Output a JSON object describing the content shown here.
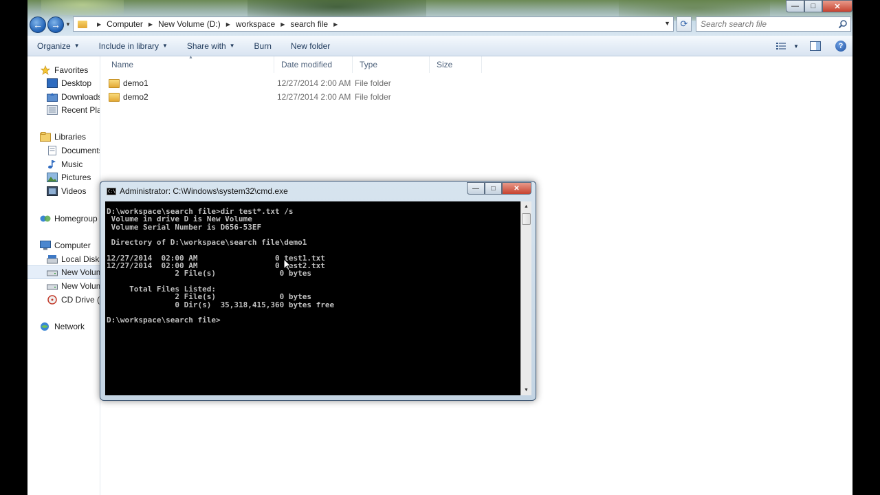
{
  "window": {
    "controls": {
      "minimize": "—",
      "maximize": "□",
      "close": "✕"
    }
  },
  "nav": {
    "back_symbol": "←",
    "forward_symbol": "→",
    "breadcrumbs": [
      "Computer",
      "New Volume (D:)",
      "workspace",
      "search file"
    ],
    "refresh_symbol": "⟳",
    "search_placeholder": "Search search file"
  },
  "toolbar": {
    "organize": "Organize",
    "include_in_library": "Include in library",
    "share_with": "Share with",
    "burn": "Burn",
    "new_folder": "New folder"
  },
  "sidebar": {
    "favorites": "Favorites",
    "desktop": "Desktop",
    "downloads": "Downloads",
    "recent_places": "Recent Plac",
    "libraries": "Libraries",
    "documents": "Documents",
    "music": "Music",
    "pictures": "Pictures",
    "videos": "Videos",
    "homegroup": "Homegroup",
    "computer": "Computer",
    "local_disk": "Local Disk",
    "new_volume_1": "New Volum",
    "new_volume_2": "New Volum",
    "cd_drive": "CD Drive (G",
    "network": "Network"
  },
  "filelist": {
    "columns": {
      "name": "Name",
      "date_modified": "Date modified",
      "type": "Type",
      "size": "Size"
    },
    "rows": [
      {
        "name": "demo1",
        "date": "12/27/2014 2:00 AM",
        "type": "File folder"
      },
      {
        "name": "demo2",
        "date": "12/27/2014 2:00 AM",
        "type": "File folder"
      }
    ]
  },
  "cmd": {
    "title": "Administrator: C:\\Windows\\system32\\cmd.exe",
    "icon_text": "C:\\",
    "output": "D:\\workspace\\search file>dir test*.txt /s\n Volume in drive D is New Volume\n Volume Serial Number is D656-53EF\n\n Directory of D:\\workspace\\search file\\demo1\n\n12/27/2014  02:00 AM                 0 test1.txt\n12/27/2014  02:00 AM                 0 test2.txt\n               2 File(s)              0 bytes\n\n     Total Files Listed:\n               2 File(s)              0 bytes\n               0 Dir(s)  35,318,415,360 bytes free\n\nD:\\workspace\\search file>"
  },
  "colors": {
    "accent": "#1e395b",
    "console_bg": "#000000",
    "console_fg": "#c0c0c0"
  }
}
